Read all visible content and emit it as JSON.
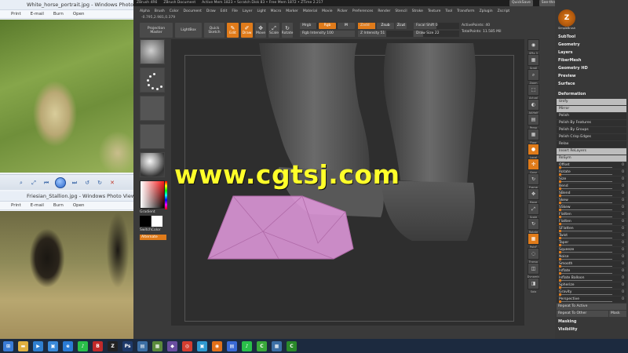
{
  "photo_viewer_1": {
    "title": "White_horse_portrait.jpg - Windows Photo Viewer",
    "menu": [
      "Print",
      "E-mail",
      "Burn",
      "Open"
    ]
  },
  "photo_viewer_2": {
    "title": "Friesian_Stallion.jpg - Windows Photo Viewer",
    "menu": [
      "Print",
      "E-mail",
      "Burn",
      "Open"
    ]
  },
  "zbrush": {
    "title_bar": {
      "app": "ZBrush 4R6",
      "document": "ZBrush Document",
      "status": "Active Mem 1823 • Scratch Disk 83 • Free Mem 1872 • ZTime 2.217",
      "quicksave": "QuickSave",
      "see_through": "See-through 0",
      "menus_btn": "Menus",
      "script": "DefaultZScript"
    },
    "menu": [
      "Alpha",
      "Brush",
      "Color",
      "Document",
      "Draw",
      "Edit",
      "File",
      "Layer",
      "Light",
      "Macro",
      "Marker",
      "Material",
      "Movie",
      "Picker",
      "Preferences",
      "Render",
      "Stencil",
      "Stroke",
      "Texture",
      "Tool",
      "Transform",
      "Zplugin",
      "Zscript"
    ],
    "coords": "-0.795,2.981,0.379",
    "toolbar": {
      "projection_master": "Projection Master",
      "lightbox": "LightBox",
      "quick_sketch": "Quick Sketch",
      "edit": "Edit",
      "draw": "Draw",
      "move": "Move",
      "scale": "Scale",
      "rotate": "Rotate",
      "mrgb": "Mrgb",
      "rgb": "Rgb",
      "m": "M",
      "rgb_intensity": "Rgb Intensity 100",
      "zadd": "Zadd",
      "zsub": "Zsub",
      "zcut": "Zcut",
      "z_intensity": "Z Intensity 51",
      "focal_shift": "Focal Shift 0",
      "draw_size": "Draw Size 22",
      "dynamic": "Dynamic",
      "active_points": "ActivePoints: 40",
      "total_points": "TotalPoints: 11.585 Mil"
    },
    "left_shelf": {
      "gradient_label": "Gradient",
      "switch_color_label": "SwitchColor",
      "alternate_label": "Alternate"
    },
    "right_icons": [
      {
        "icon": "◉",
        "label": "SPix 3"
      },
      {
        "icon": "▦",
        "label": "Scroll"
      },
      {
        "icon": "⌕",
        "label": "Zoom"
      },
      {
        "icon": "⬚",
        "label": "Actual"
      },
      {
        "icon": "◐",
        "label": "AAHalf"
      },
      {
        "icon": "▤",
        "label": "Persp"
      },
      {
        "icon": "▦",
        "label": "Floor"
      },
      {
        "icon": "●",
        "label": "Local"
      },
      {
        "icon": "✣",
        "label": "Gxyz"
      },
      {
        "icon": "↻",
        "label": "Frame"
      },
      {
        "icon": "✥",
        "label": "Move"
      },
      {
        "icon": "⤢",
        "label": "Scale"
      },
      {
        "icon": "↻",
        "label": "Rotate"
      },
      {
        "icon": "▦",
        "label": "PolyF"
      },
      {
        "icon": "◌",
        "label": "Transp"
      },
      {
        "icon": "◫",
        "label": "Dynamic"
      },
      {
        "icon": "◨",
        "label": "Solo"
      }
    ],
    "right_panel": {
      "logo_caption": "SimpleBrush",
      "headers": [
        "SubTool",
        "Geometry",
        "Layers",
        "FiberMesh",
        "Geometry HD",
        "Preview",
        "Surface"
      ],
      "deformation_header": "Deformation",
      "deformation_items": [
        {
          "label": "Unify",
          "light": true,
          "value": ""
        },
        {
          "label": "Mirror",
          "light": true,
          "value": ""
        },
        {
          "label": "Polish",
          "light": false,
          "value": ""
        },
        {
          "label": "Polish By Features",
          "light": false,
          "value": ""
        },
        {
          "label": "Polish By Groups",
          "light": false,
          "value": ""
        },
        {
          "label": "Polish Crisp Edges",
          "light": false,
          "value": ""
        },
        {
          "label": "Relax",
          "light": false,
          "value": ""
        },
        {
          "label": "Insert ReLayers",
          "light": true,
          "value": ""
        },
        {
          "label": "ReSym",
          "light": true,
          "value": ""
        },
        {
          "label": "Offset",
          "light": false,
          "value": "0"
        },
        {
          "label": "Rotate",
          "light": false,
          "value": "0"
        },
        {
          "label": "Size",
          "light": false,
          "value": "0"
        },
        {
          "label": "Bend",
          "light": false,
          "value": "0"
        },
        {
          "label": "SBend",
          "light": false,
          "value": "0"
        },
        {
          "label": "Skew",
          "light": false,
          "value": "0"
        },
        {
          "label": "SSkew",
          "light": false,
          "value": "0"
        },
        {
          "label": "Flatten",
          "light": false,
          "value": "0"
        },
        {
          "label": "Flatten",
          "light": false,
          "value": "0"
        },
        {
          "label": "SFlatten",
          "light": false,
          "value": "0"
        },
        {
          "label": "Twist",
          "light": false,
          "value": "0"
        },
        {
          "label": "Taper",
          "light": false,
          "value": "0"
        },
        {
          "label": "Squeeze",
          "light": false,
          "value": "0"
        },
        {
          "label": "Noise",
          "light": false,
          "value": "0"
        },
        {
          "label": "Smooth",
          "light": false,
          "value": "0"
        },
        {
          "label": "Inflate",
          "light": false,
          "value": "0"
        },
        {
          "label": "Inflate Balloon",
          "light": false,
          "value": "0"
        },
        {
          "label": "Spherize",
          "light": false,
          "value": "0"
        },
        {
          "label": "Gravity",
          "light": false,
          "value": "0"
        },
        {
          "label": "Perspective",
          "light": false,
          "value": "0"
        }
      ],
      "repeat_to_active": "Repeat To Active",
      "repeat_to_other": "Repeat To Other",
      "mask": "Mask",
      "masking": "Masking",
      "visibility": "Visibility"
    }
  },
  "watermark": "www.cgtsj.com",
  "taskbar": [
    {
      "name": "start",
      "glyph": "⊞",
      "color": "#3a7bd5"
    },
    {
      "name": "explorer",
      "glyph": "▬",
      "color": "#e0b040"
    },
    {
      "name": "media",
      "glyph": "▶",
      "color": "#2f7fd0"
    },
    {
      "name": "photos",
      "glyph": "▣",
      "color": "#3a8ad9"
    },
    {
      "name": "ie",
      "glyph": "e",
      "color": "#2a7bd5"
    },
    {
      "name": "spotify",
      "glyph": "♪",
      "color": "#2abf4a"
    },
    {
      "name": "b",
      "glyph": "B",
      "color": "#c02a2a"
    },
    {
      "name": "zbrush",
      "glyph": "Z",
      "color": "#222"
    },
    {
      "name": "ps",
      "glyph": "Ps",
      "color": "#1e3a6a"
    },
    {
      "name": "app",
      "glyph": "▤",
      "color": "#3c6fa5"
    },
    {
      "name": "app2",
      "glyph": "▦",
      "color": "#5a8a3c"
    },
    {
      "name": "app3",
      "glyph": "◆",
      "color": "#6a4ea0"
    },
    {
      "name": "chrome",
      "glyph": "◎",
      "color": "#d43e30"
    },
    {
      "name": "app4",
      "glyph": "▣",
      "color": "#2f9ad0"
    },
    {
      "name": "firefox",
      "glyph": "◉",
      "color": "#e0701a"
    },
    {
      "name": "app5",
      "glyph": "▤",
      "color": "#3a6ad5"
    },
    {
      "name": "spotify2",
      "glyph": "♪",
      "color": "#2abf4a"
    },
    {
      "name": "camtasia",
      "glyph": "C",
      "color": "#3aa83a"
    },
    {
      "name": "app6",
      "glyph": "▦",
      "color": "#3c6fa5"
    },
    {
      "name": "camtasia2",
      "glyph": "C",
      "color": "#2a8a2a"
    }
  ]
}
